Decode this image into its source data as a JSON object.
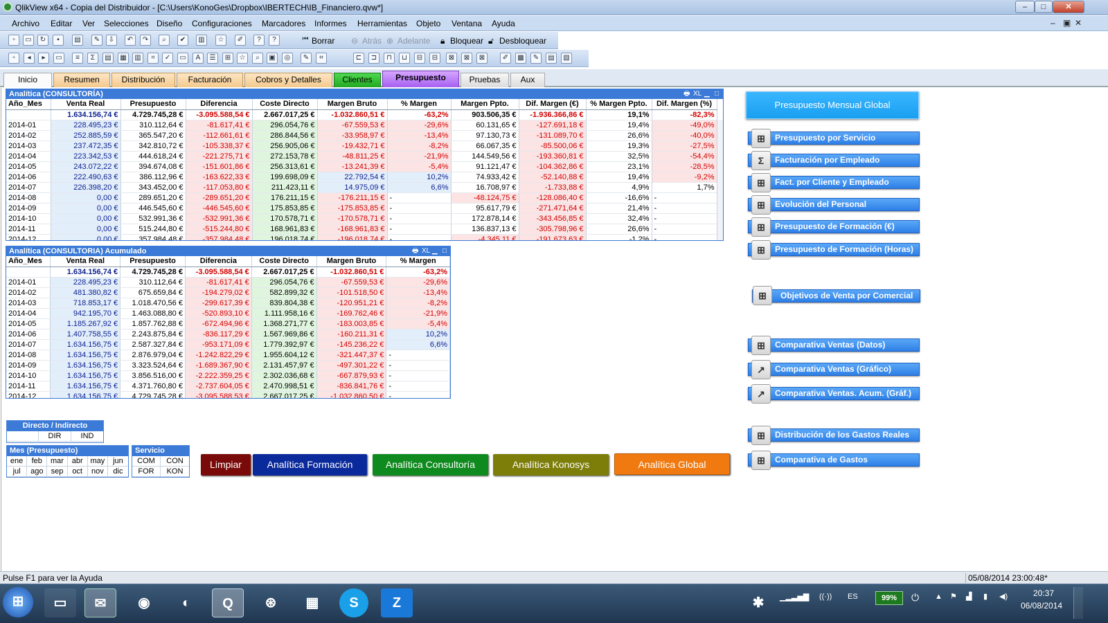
{
  "window": {
    "title": "QlikView x64 - Copia del Distribuidor - [C:\\Users\\KonoGes\\Dropbox\\IBERTECH\\IB_Financiero.qvw*]",
    "min": "–",
    "max": "□",
    "close": "✕"
  },
  "menu": [
    "Archivo",
    "Editar",
    "Ver",
    "Selecciones",
    "Diseño",
    "Configuraciones",
    "Marcadores",
    "Informes",
    "Herramientas",
    "Objeto",
    "Ventana",
    "Ayuda"
  ],
  "mdi": {
    "min": "–",
    "restore": "▣",
    "close": "✕"
  },
  "toolbar": {
    "borrar": "Borrar",
    "atras": "Atrás",
    "adelante": "Adelante",
    "bloquear": "Bloquear",
    "desbloquear": "Desbloquear"
  },
  "tabs": [
    "Inicio",
    "Resumen",
    "Distribución",
    "Facturación",
    "Cobros y Detalles",
    "Clientes",
    "Presupuesto",
    "Pruebas",
    "Aux"
  ],
  "t1": {
    "title": "Analítica (CONSULTORÍA)",
    "xl": "XL",
    "headers": [
      "Año_Mes",
      "Venta Real",
      "Presupuesto",
      "Diferencia",
      "Coste Directo",
      "Margen Bruto",
      "% Margen",
      "Margen Ppto.",
      "Dif. Margen (€)",
      "% Margen Ppto.",
      "Dif. Margen (%)"
    ],
    "total": [
      "",
      "1.634.156,74 €",
      "4.729.745,28 €",
      "-3.095.588,54 €",
      "2.667.017,25 €",
      "-1.032.860,51 €",
      "-63,2%",
      "903.506,35 €",
      "-1.936.366,86 €",
      "19,1%",
      "-82,3%"
    ],
    "rows": [
      [
        "2014-01",
        "228.495,23 €",
        "310.112,64 €",
        "-81.617,41 €",
        "296.054,76 €",
        "-67.559,53 €",
        "-29,6%",
        "60.131,65 €",
        "-127.691,18 €",
        "19,4%",
        "-49,0%"
      ],
      [
        "2014-02",
        "252.885,59 €",
        "365.547,20 €",
        "-112.661,61 €",
        "286.844,56 €",
        "-33.958,97 €",
        "-13,4%",
        "97.130,73 €",
        "-131.089,70 €",
        "26,6%",
        "-40,0%"
      ],
      [
        "2014-03",
        "237.472,35 €",
        "342.810,72 €",
        "-105.338,37 €",
        "256.905,06 €",
        "-19.432,71 €",
        "-8,2%",
        "66.067,35 €",
        "-85.500,06 €",
        "19,3%",
        "-27,5%"
      ],
      [
        "2014-04",
        "223.342,53 €",
        "444.618,24 €",
        "-221.275,71 €",
        "272.153,78 €",
        "-48.811,25 €",
        "-21,9%",
        "144.549,56 €",
        "-193.360,81 €",
        "32,5%",
        "-54,4%"
      ],
      [
        "2014-05",
        "243.072,22 €",
        "394.674,08 €",
        "-151.601,86 €",
        "256.313,61 €",
        "-13.241,39 €",
        "-5,4%",
        "91.121,47 €",
        "-104.362,86 €",
        "23,1%",
        "-28,5%"
      ],
      [
        "2014-06",
        "222.490,63 €",
        "386.112,96 €",
        "-163.622,33 €",
        "199.698,09 €",
        "22.792,54 €",
        "10,2%",
        "74.933,42 €",
        "-52.140,88 €",
        "19,4%",
        "-9,2%"
      ],
      [
        "2014-07",
        "226.398,20 €",
        "343.452,00 €",
        "-117.053,80 €",
        "211.423,11 €",
        "14.975,09 €",
        "6,6%",
        "16.708,97 €",
        "-1.733,88 €",
        "4,9%",
        "1,7%"
      ],
      [
        "2014-08",
        "0,00 €",
        "289.651,20 €",
        "-289.651,20 €",
        "176.211,15 €",
        "-176.211,15 €",
        "-",
        "-48.124,75 €",
        "-128.086,40 €",
        "-16,6%",
        "-"
      ],
      [
        "2014-09",
        "0,00 €",
        "446.545,60 €",
        "-446.545,60 €",
        "175.853,85 €",
        "-175.853,85 €",
        "-",
        "95.617,79 €",
        "-271.471,64 €",
        "21,4%",
        "-"
      ],
      [
        "2014-10",
        "0,00 €",
        "532.991,36 €",
        "-532.991,36 €",
        "170.578,71 €",
        "-170.578,71 €",
        "-",
        "172.878,14 €",
        "-343.456,85 €",
        "32,4%",
        "-"
      ],
      [
        "2014-11",
        "0,00 €",
        "515.244,80 €",
        "-515.244,80 €",
        "168.961,83 €",
        "-168.961,83 €",
        "-",
        "136.837,13 €",
        "-305.798,96 €",
        "26,6%",
        "-"
      ],
      [
        "2014-12",
        "0,00 €",
        "357.984,48 €",
        "-357.984,48 €",
        "196.018,74 €",
        "-196.018,74 €",
        "-",
        "-4.345,11 €",
        "-191.673,63 €",
        "-1,2%",
        "-"
      ]
    ]
  },
  "t2": {
    "title": "Analítica (CONSULTORIA) Acumulado",
    "xl": "XL",
    "headers": [
      "Año_Mes",
      "Venta Real",
      "Presupuesto",
      "Diferencia",
      "Coste Directo",
      "Margen Bruto",
      "% Margen"
    ],
    "total": [
      "",
      "1.634.156,74 €",
      "4.729.745,28 €",
      "-3.095.588,54 €",
      "2.667.017,25 €",
      "-1.032.860,51 €",
      "-63,2%"
    ],
    "rows": [
      [
        "2014-01",
        "228.495,23 €",
        "310.112,64 €",
        "-81.617,41 €",
        "296.054,76 €",
        "-67.559,53 €",
        "-29,6%"
      ],
      [
        "2014-02",
        "481.380,82 €",
        "675.659,84 €",
        "-194.279,02 €",
        "582.899,32 €",
        "-101.518,50 €",
        "-13,4%"
      ],
      [
        "2014-03",
        "718.853,17 €",
        "1.018.470,56 €",
        "-299.617,39 €",
        "839.804,38 €",
        "-120.951,21 €",
        "-8,2%"
      ],
      [
        "2014-04",
        "942.195,70 €",
        "1.463.088,80 €",
        "-520.893,10 €",
        "1.111.958,16 €",
        "-169.762,46 €",
        "-21,9%"
      ],
      [
        "2014-05",
        "1.185.267,92 €",
        "1.857.762,88 €",
        "-672.494,96 €",
        "1.368.271,77 €",
        "-183.003,85 €",
        "-5,4%"
      ],
      [
        "2014-06",
        "1.407.758,55 €",
        "2.243.875,84 €",
        "-836.117,29 €",
        "1.567.969,86 €",
        "-160.211,31 €",
        "10,2%"
      ],
      [
        "2014-07",
        "1.634.156,75 €",
        "2.587.327,84 €",
        "-953.171,09 €",
        "1.779.392,97 €",
        "-145.236,22 €",
        "6,6%"
      ],
      [
        "2014-08",
        "1.634.156,75 €",
        "2.876.979,04 €",
        "-1.242.822,29 €",
        "1.955.604,12 €",
        "-321.447,37 €",
        "-"
      ],
      [
        "2014-09",
        "1.634.156,75 €",
        "3.323.524,64 €",
        "-1.689.367,90 €",
        "2.131.457,97 €",
        "-497.301,22 €",
        "-"
      ],
      [
        "2014-10",
        "1.634.156,75 €",
        "3.856.516,00 €",
        "-2.222.359,25 €",
        "2.302.036,68 €",
        "-667.879,93 €",
        "-"
      ],
      [
        "2014-11",
        "1.634.156,75 €",
        "4.371.760,80 €",
        "-2.737.604,05 €",
        "2.470.998,51 €",
        "-836.841,76 €",
        "-"
      ],
      [
        "2014-12",
        "1.634.156,75 €",
        "4.729.745,28 €",
        "-3.095.588,53 €",
        "2.667.017,25 €",
        "-1.032.860,50 €",
        "-"
      ]
    ]
  },
  "listboxes": {
    "directo": {
      "title": "Directo / Indirecto",
      "values": [
        "",
        "DIR",
        "IND"
      ]
    },
    "mes": {
      "title": "Mes (Presupuesto)",
      "values": [
        "ene",
        "feb",
        "mar",
        "abr",
        "may",
        "jun",
        "jul",
        "ago",
        "sep",
        "oct",
        "nov",
        "dic"
      ]
    },
    "servicio": {
      "title": "Servicio",
      "values": [
        "COM",
        "CON",
        "FOR",
        "KON"
      ]
    }
  },
  "actions": {
    "limpiar": "Limpiar",
    "formacion": "Analítica Formación",
    "consultoria": "Analítica Consultoría",
    "konosys": "Analítica Konosys",
    "global": "Analítica Global"
  },
  "colors": {
    "formacion": "#0a2a9c",
    "consultoria": "#0f8a1e",
    "konosys": "#7d7d0a",
    "global": "#f07a10",
    "limpiar": "#7a0a0a",
    "accent": "#3b7ad6"
  },
  "presupuesto_mensual": "Presupuesto Mensual Global",
  "nav": [
    "Presupuesto por Servicio",
    "Facturación por Empleado",
    "Fact. por Cliente y Empleado",
    "Evolución del Personal",
    "Presupuesto de Formación (€)",
    "Presupuesto de Formación (Horas)",
    "Objetivos de Venta por Comercial",
    "Comparativa Ventas (Datos)",
    "Comparativa Ventas (Gráfico)",
    "Comparativa Ventas. Acum. (Gráf.)",
    "Distribución de los Gastos Reales",
    "Comparativa de Gastos"
  ],
  "status": {
    "help": "Pulse F1 para ver la Ayuda",
    "datetime": "05/08/2014 23:00:48*"
  },
  "taskbar": {
    "lang": "ES",
    "battery": "99%",
    "time": "20:37",
    "date": "06/08/2014",
    "z": "Z"
  }
}
